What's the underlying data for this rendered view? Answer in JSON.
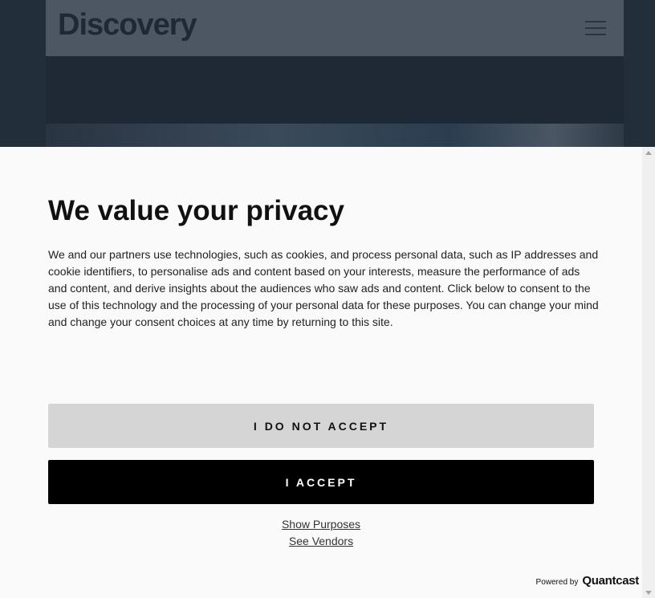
{
  "site": {
    "logo_text": "Discovery"
  },
  "consent": {
    "title": "We value your privacy",
    "body": "We and our partners use technologies, such as cookies, and process personal data, such as IP addresses and cookie identifiers, to personalise ads and content based on your interests, measure the performance of ads and content, and derive insights about the audiences who saw ads and content. Click below to consent to the use of this technology and the processing of your personal data for these purposes. You can change your mind and change your consent choices at any time by returning to this site.",
    "reject_label": "I DO NOT ACCEPT",
    "accept_label": "I ACCEPT",
    "purposes_link": "Show Purposes",
    "vendors_link": "See Vendors",
    "powered_by_label": "Powered by",
    "powered_by_brand": "Quantcast"
  }
}
